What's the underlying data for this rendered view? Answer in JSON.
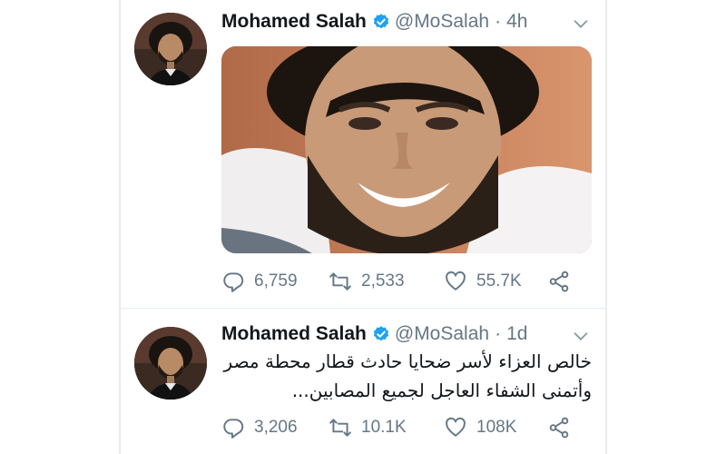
{
  "tweets": [
    {
      "name": "Mohamed Salah",
      "handle": "@MoSalah",
      "separator": "·",
      "time": "4h",
      "text": "",
      "reply_count": "6,759",
      "retweet_count": "2,533",
      "like_count": "55.7K"
    },
    {
      "name": "Mohamed Salah",
      "handle": "@MoSalah",
      "separator": "·",
      "time": "1d",
      "text_line1": "خالص العزاء لأسر ضحايا حادث قطار محطة مصر",
      "text_line2": "وأتمنى الشفاء العاجل لجميع المصابين...",
      "reply_count": "3,206",
      "retweet_count": "10.1K",
      "like_count": "108K"
    }
  ],
  "colors": {
    "verified_badge": "#1da1f2",
    "secondary_text": "#657786",
    "primary_text": "#14171a"
  },
  "icons": [
    "verified-badge-icon",
    "chevron-down-icon",
    "reply-icon",
    "retweet-icon",
    "like-icon",
    "share-icon"
  ]
}
